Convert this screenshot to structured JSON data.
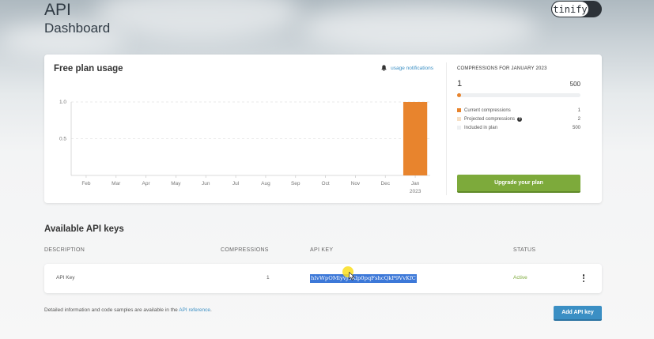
{
  "page": {
    "title_line1": "API",
    "title_line2": "Dashboard",
    "logo": "tinify"
  },
  "usage": {
    "title": "Free plan usage",
    "notifications_label": "usage notifications",
    "notifications_icon": "bell-icon"
  },
  "chart_data": {
    "type": "bar",
    "title": "",
    "xlabel": "",
    "ylabel": "",
    "categories": [
      "Feb",
      "Mar",
      "Apr",
      "May",
      "Jun",
      "Jul",
      "Aug",
      "Sep",
      "Oct",
      "Nov",
      "Dec",
      "Jan"
    ],
    "category_sublabels": [
      "",
      "",
      "",
      "",
      "",
      "",
      "",
      "",
      "",
      "",
      "",
      "2023"
    ],
    "values": [
      0,
      0,
      0,
      0,
      0,
      0,
      0,
      0,
      0,
      0,
      0,
      1
    ],
    "ylim": [
      0,
      1.0
    ],
    "y_ticks": [
      "1.0",
      "0.5"
    ],
    "grid": "horizontal dashed",
    "bar_color": "#e8842d"
  },
  "compressions": {
    "title": "COMPRESSIONS FOR JANUARY 2023",
    "current": "1",
    "max": "500",
    "progress_fraction": 0.002,
    "legend": [
      {
        "label": "Current compressions",
        "value": "1",
        "color": "#e8842d",
        "help": false
      },
      {
        "label": "Projected compressions",
        "value": "2",
        "color": "#f6dfc4",
        "help": true
      },
      {
        "label": "Included in plan",
        "value": "500",
        "color": "#eef0f2",
        "help": false
      }
    ],
    "upgrade_label": "Upgrade your plan"
  },
  "api_keys": {
    "section_title": "Available API keys",
    "columns": [
      "DESCRIPTION",
      "COMPRESSIONS",
      "API KEY",
      "STATUS"
    ],
    "rows": [
      {
        "description": "API Key",
        "compressions": "1",
        "api_key": "hIvWpOMlyvJ3Klp0pqFshcQkP9VvKfC",
        "status": "Active"
      }
    ],
    "footer_text": "Detailed information and code samples are available in the",
    "footer_link": "API reference",
    "footer_end": ".",
    "add_label": "Add API key"
  },
  "colors": {
    "accent_orange": "#e8842d",
    "accent_green": "#7daa3b",
    "accent_blue": "#3b8fc4"
  }
}
